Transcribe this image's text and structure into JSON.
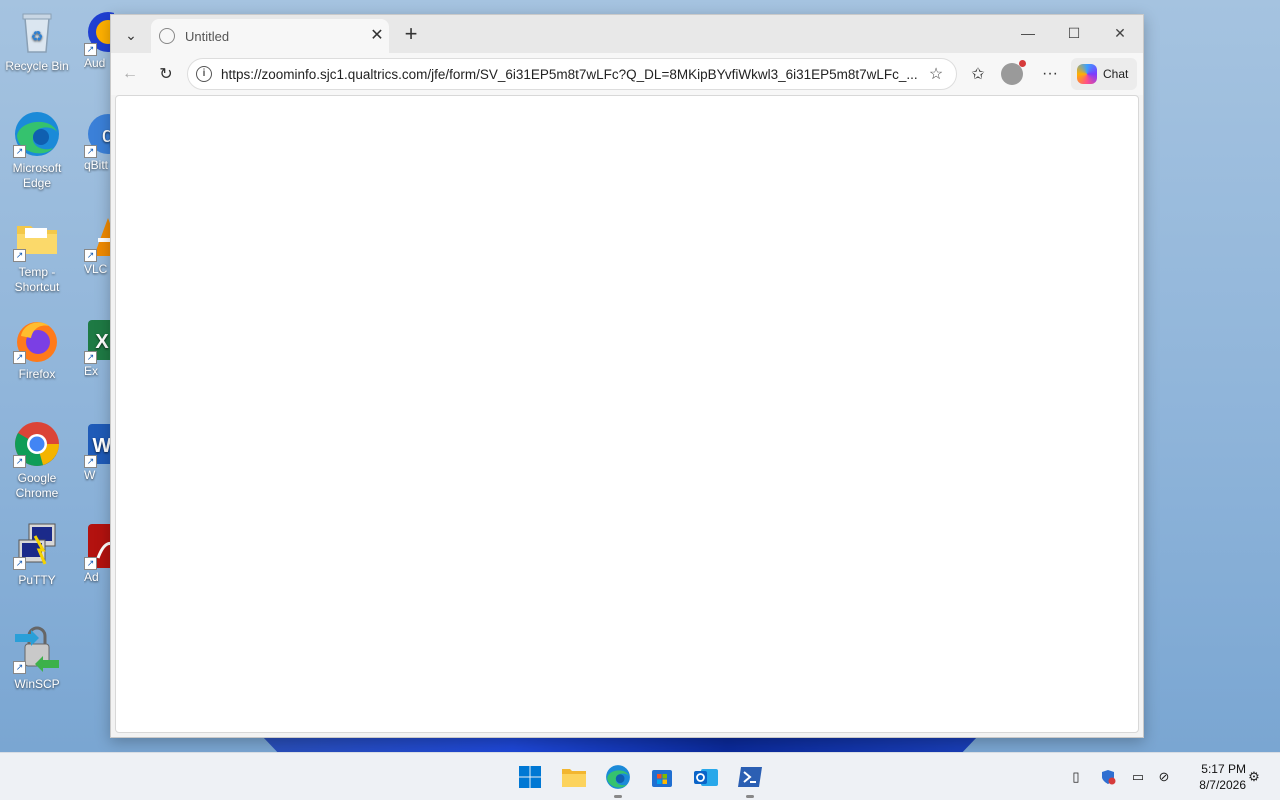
{
  "desktop": {
    "icons": [
      {
        "label": "Recycle Bin",
        "icon": "recycle-bin-icon"
      },
      {
        "label": "Microsoft Edge",
        "icon": "edge-icon"
      },
      {
        "label": "Temp - Shortcut",
        "icon": "folder-icon"
      },
      {
        "label": "Firefox",
        "icon": "firefox-icon"
      },
      {
        "label": "Google Chrome",
        "icon": "chrome-icon"
      },
      {
        "label": "PuTTY",
        "icon": "putty-icon"
      },
      {
        "label": "WinSCP",
        "icon": "winscp-icon"
      }
    ],
    "partial_icons": [
      {
        "label": "Aud",
        "icon": "audacity-icon"
      },
      {
        "label": "qBitt",
        "icon": "qbittorrent-icon"
      },
      {
        "label": "VLC",
        "icon": "vlc-icon"
      },
      {
        "label": "Ex",
        "icon": "excel-icon"
      },
      {
        "label": "W",
        "icon": "word-icon"
      },
      {
        "label": "Ad",
        "icon": "acrobat-icon"
      }
    ]
  },
  "browser": {
    "tab_title": "Untitled",
    "url": "https://zoominfo.sjc1.qualtrics.com/jfe/form/SV_6i31EP5m8t7wLFc?Q_DL=8MKipBYvfiWkwl3_6i31EP5m8t7wLFc_...",
    "chat_label": "Chat"
  },
  "taskbar": {
    "apps": [
      "start",
      "file-explorer",
      "edge",
      "microsoft-store",
      "outlook",
      "powershell"
    ],
    "time": "5:17 PM",
    "date": "8/7/2026"
  },
  "colors": {
    "desktop_top": "#a5c3e0",
    "taskbar": "#eef1f5",
    "accent": "#0067c0"
  }
}
